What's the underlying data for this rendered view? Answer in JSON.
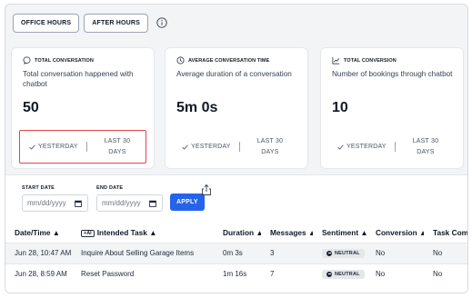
{
  "tabs": [
    {
      "label": "OFFICE HOURS"
    },
    {
      "label": "AFTER HOURS"
    }
  ],
  "cards": [
    {
      "icon": "chat-bubble-icon",
      "title": "TOTAL CONVERSATION",
      "description": "Total conversation happened with chatbot",
      "value": "50",
      "yesterday": "YESTERDAY",
      "last30_line1": "LAST 30",
      "last30_line2": "DAYS"
    },
    {
      "icon": "clock-icon",
      "title": "AVERAGE CONVERSATION TIME",
      "description": "Average duration of a conversation",
      "value": "5m 0s",
      "yesterday": "YESTERDAY",
      "last30_line1": "LAST 30",
      "last30_line2": "DAYS"
    },
    {
      "icon": "trend-icon",
      "title": "TOTAL CONVERSION",
      "description": "Number of bookings through chatbot",
      "value": "10",
      "yesterday": "YESTERDAY",
      "last30_line1": "LAST 30",
      "last30_line2": "DAYS"
    }
  ],
  "filters": {
    "start_label": "START DATE",
    "start_placeholder": "mm/dd/yyyy",
    "end_label": "END DATE",
    "end_placeholder": "mm/dd/yyyy",
    "apply_label": "APPLY"
  },
  "table": {
    "ai_badge": "+AI",
    "headers": [
      "Date/Time ▲",
      "Intended Task ▲",
      "Duration ▲",
      "Messages ▲",
      "Sentiment ▲",
      "Conversion ▲",
      "Task Com"
    ],
    "rows": [
      {
        "datetime": "Jun 28, 10:47 AM",
        "task": "Inquire About Selling Garage Items",
        "duration": "0m 3s",
        "messages": "3",
        "sentiment": "NEUTRAL",
        "conversion": "No",
        "task_complete": "No"
      },
      {
        "datetime": "Jun 28, 8:59 AM",
        "task": "Reset Password",
        "duration": "1m 16s",
        "messages": "7",
        "sentiment": "NEUTRAL",
        "conversion": "No",
        "task_complete": "No"
      }
    ]
  },
  "colors": {
    "accent": "#2563eb",
    "highlight_border": "#e0464a"
  }
}
